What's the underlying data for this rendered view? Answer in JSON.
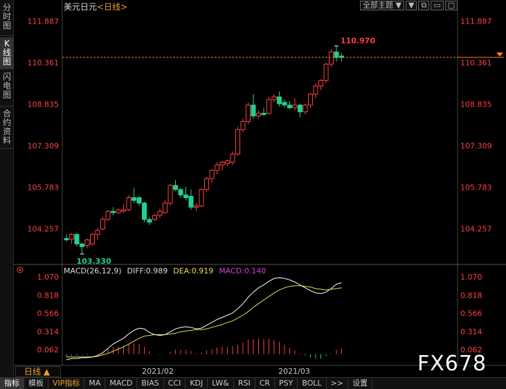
{
  "left_tabs": [
    {
      "label": "分时图",
      "chars": [
        "分",
        "时",
        "图"
      ],
      "active": false
    },
    {
      "label": "K线图",
      "chars": [
        "K",
        "线",
        "图"
      ],
      "active": true
    },
    {
      "label": "闪电图",
      "chars": [
        "闪",
        "电",
        "图"
      ],
      "active": false
    },
    {
      "label": "合约资料",
      "chars": [
        "合",
        "约",
        "资",
        "料"
      ],
      "active": false
    }
  ],
  "header": {
    "symbol": "美元日元",
    "period": "<日线>"
  },
  "topbar": {
    "all_topics": "全部主题",
    "dropdown_icon": "caret-down-icon",
    "buttons": [
      "▼",
      "⧉",
      "▭",
      "▢"
    ]
  },
  "colors": {
    "up": "#ff4040",
    "down": "#20d090",
    "axis_text": "#ff4040",
    "diff_line": "#ffffff",
    "dea_line": "#e8e050",
    "macd_label": "#d040d0",
    "last_price_line": "#ff8020"
  },
  "price_axis": {
    "ticks": [
      "111.887",
      "110.361",
      "108.835",
      "107.309",
      "105.783",
      "104.257"
    ]
  },
  "annotations": {
    "high": "110.970",
    "low": "103.330"
  },
  "date_axis": {
    "labels": [
      "2021/02",
      "2021/03"
    ]
  },
  "macd": {
    "name": "MACD(26,12,9)",
    "diff": "DIFF:0.989",
    "dea": "DEA:0.919",
    "macd": "MACD:0.140",
    "ticks": [
      "1.070",
      "0.818",
      "0.566",
      "0.314",
      "0.062"
    ]
  },
  "period_label": "日线 ▲",
  "bottom_tabs": [
    "指标",
    "模板",
    "VIP指标",
    "MA",
    "MACD",
    "BIAS",
    "CCI",
    "KDJ",
    "LW&",
    "RSI",
    "CR",
    "PSY",
    "BOLL",
    ">>",
    "设置"
  ],
  "watermark": "FX678",
  "chart_data": {
    "type": "candlestick",
    "symbol": "美元日元",
    "price_range": [
      103.0,
      112.2
    ],
    "candles": [
      {
        "o": 103.9,
        "h": 104.05,
        "l": 103.8,
        "c": 103.85
      },
      {
        "o": 103.88,
        "h": 104.1,
        "l": 103.7,
        "c": 104.05
      },
      {
        "o": 104.05,
        "h": 104.1,
        "l": 103.6,
        "c": 103.7
      },
      {
        "o": 103.7,
        "h": 103.75,
        "l": 103.33,
        "c": 103.6
      },
      {
        "o": 103.65,
        "h": 103.9,
        "l": 103.55,
        "c": 103.85
      },
      {
        "o": 103.7,
        "h": 104.1,
        "l": 103.65,
        "c": 104.05
      },
      {
        "o": 104.05,
        "h": 104.3,
        "l": 103.85,
        "c": 104.2
      },
      {
        "o": 104.25,
        "h": 104.7,
        "l": 104.2,
        "c": 104.6
      },
      {
        "o": 104.6,
        "h": 104.95,
        "l": 104.55,
        "c": 104.9
      },
      {
        "o": 104.9,
        "h": 105.05,
        "l": 104.75,
        "c": 104.85
      },
      {
        "o": 104.85,
        "h": 105.0,
        "l": 104.8,
        "c": 104.95
      },
      {
        "o": 104.9,
        "h": 105.15,
        "l": 104.85,
        "c": 104.95
      },
      {
        "o": 104.95,
        "h": 105.5,
        "l": 104.9,
        "c": 105.4
      },
      {
        "o": 105.4,
        "h": 105.76,
        "l": 105.2,
        "c": 105.3
      },
      {
        "o": 105.4,
        "h": 105.45,
        "l": 105.1,
        "c": 105.2
      },
      {
        "o": 105.2,
        "h": 105.25,
        "l": 104.5,
        "c": 104.6
      },
      {
        "o": 104.6,
        "h": 104.7,
        "l": 104.4,
        "c": 104.5
      },
      {
        "o": 104.6,
        "h": 104.8,
        "l": 104.55,
        "c": 104.75
      },
      {
        "o": 104.75,
        "h": 105.0,
        "l": 104.65,
        "c": 104.9
      },
      {
        "o": 104.85,
        "h": 105.3,
        "l": 104.8,
        "c": 105.2
      },
      {
        "o": 105.2,
        "h": 105.9,
        "l": 105.1,
        "c": 105.85
      },
      {
        "o": 105.85,
        "h": 106.05,
        "l": 105.65,
        "c": 105.7
      },
      {
        "o": 105.7,
        "h": 105.75,
        "l": 105.4,
        "c": 105.5
      },
      {
        "o": 105.5,
        "h": 105.8,
        "l": 105.3,
        "c": 105.4
      },
      {
        "o": 105.45,
        "h": 105.7,
        "l": 104.95,
        "c": 105.05
      },
      {
        "o": 105.05,
        "h": 105.2,
        "l": 104.9,
        "c": 105.1
      },
      {
        "o": 105.1,
        "h": 105.75,
        "l": 105.05,
        "c": 105.7
      },
      {
        "o": 105.7,
        "h": 106.15,
        "l": 105.6,
        "c": 106.1
      },
      {
        "o": 106.1,
        "h": 106.45,
        "l": 105.95,
        "c": 106.4
      },
      {
        "o": 106.4,
        "h": 106.7,
        "l": 106.25,
        "c": 106.6
      },
      {
        "o": 106.6,
        "h": 106.75,
        "l": 106.4,
        "c": 106.7
      },
      {
        "o": 106.65,
        "h": 106.8,
        "l": 106.55,
        "c": 106.75
      },
      {
        "o": 106.7,
        "h": 107.1,
        "l": 106.6,
        "c": 107.0
      },
      {
        "o": 107.0,
        "h": 108.0,
        "l": 106.95,
        "c": 107.9
      },
      {
        "o": 107.9,
        "h": 108.3,
        "l": 107.8,
        "c": 108.2
      },
      {
        "o": 108.2,
        "h": 108.9,
        "l": 108.1,
        "c": 108.8
      },
      {
        "o": 108.8,
        "h": 109.2,
        "l": 108.3,
        "c": 108.4
      },
      {
        "o": 108.4,
        "h": 108.6,
        "l": 108.3,
        "c": 108.5
      },
      {
        "o": 108.5,
        "h": 108.7,
        "l": 108.4,
        "c": 108.45
      },
      {
        "o": 108.5,
        "h": 109.1,
        "l": 108.45,
        "c": 109.0
      },
      {
        "o": 109.0,
        "h": 109.2,
        "l": 108.9,
        "c": 109.1
      },
      {
        "o": 109.1,
        "h": 109.3,
        "l": 108.75,
        "c": 108.85
      },
      {
        "o": 108.9,
        "h": 109.0,
        "l": 108.7,
        "c": 108.8
      },
      {
        "o": 108.8,
        "h": 108.95,
        "l": 108.65,
        "c": 108.7
      },
      {
        "o": 108.7,
        "h": 109.05,
        "l": 108.6,
        "c": 108.8
      },
      {
        "o": 108.8,
        "h": 108.85,
        "l": 108.35,
        "c": 108.55
      },
      {
        "o": 108.55,
        "h": 108.85,
        "l": 108.45,
        "c": 108.8
      },
      {
        "o": 108.8,
        "h": 109.25,
        "l": 108.7,
        "c": 109.2
      },
      {
        "o": 109.2,
        "h": 109.6,
        "l": 109.05,
        "c": 109.5
      },
      {
        "o": 109.5,
        "h": 109.75,
        "l": 109.35,
        "c": 109.7
      },
      {
        "o": 109.7,
        "h": 110.35,
        "l": 109.6,
        "c": 110.3
      },
      {
        "o": 110.3,
        "h": 110.85,
        "l": 110.2,
        "c": 110.75
      },
      {
        "o": 110.75,
        "h": 110.97,
        "l": 110.4,
        "c": 110.55
      },
      {
        "o": 110.6,
        "h": 110.7,
        "l": 110.4,
        "c": 110.55
      }
    ],
    "last_price": 110.55,
    "high_label": 110.97,
    "low_label": 103.33,
    "macd_range": [
      -0.1,
      1.12
    ],
    "diff": [
      -0.08,
      -0.06,
      -0.06,
      -0.05,
      -0.05,
      -0.04,
      -0.02,
      0.02,
      0.08,
      0.14,
      0.18,
      0.22,
      0.28,
      0.33,
      0.36,
      0.35,
      0.3,
      0.27,
      0.26,
      0.27,
      0.31,
      0.35,
      0.37,
      0.38,
      0.37,
      0.35,
      0.36,
      0.4,
      0.44,
      0.48,
      0.51,
      0.54,
      0.57,
      0.63,
      0.7,
      0.79,
      0.86,
      0.92,
      0.96,
      1.01,
      1.05,
      1.06,
      1.05,
      1.03,
      1.0,
      0.96,
      0.92,
      0.88,
      0.85,
      0.84,
      0.86,
      0.91,
      0.97,
      0.99
    ],
    "dea": [
      -0.04,
      -0.04,
      -0.04,
      -0.04,
      -0.04,
      -0.04,
      -0.03,
      -0.01,
      0.01,
      0.04,
      0.07,
      0.1,
      0.14,
      0.18,
      0.22,
      0.25,
      0.26,
      0.27,
      0.27,
      0.27,
      0.28,
      0.29,
      0.31,
      0.32,
      0.33,
      0.34,
      0.34,
      0.35,
      0.37,
      0.39,
      0.41,
      0.44,
      0.46,
      0.5,
      0.54,
      0.59,
      0.65,
      0.7,
      0.75,
      0.8,
      0.85,
      0.89,
      0.92,
      0.94,
      0.95,
      0.95,
      0.94,
      0.93,
      0.91,
      0.9,
      0.89,
      0.9,
      0.91,
      0.92
    ],
    "macd_bar": [
      -0.04,
      -0.02,
      -0.02,
      -0.01,
      -0.01,
      0.0,
      0.01,
      0.03,
      0.07,
      0.1,
      0.11,
      0.12,
      0.14,
      0.15,
      0.14,
      0.1,
      0.04,
      0.0,
      -0.01,
      0.0,
      0.03,
      0.06,
      0.06,
      0.06,
      0.04,
      0.01,
      0.02,
      0.05,
      0.07,
      0.09,
      0.1,
      0.1,
      0.11,
      0.13,
      0.16,
      0.2,
      0.21,
      0.22,
      0.21,
      0.21,
      0.2,
      0.17,
      0.13,
      0.09,
      0.05,
      0.01,
      -0.02,
      -0.05,
      -0.06,
      -0.06,
      -0.03,
      0.01,
      0.06,
      0.07
    ]
  }
}
